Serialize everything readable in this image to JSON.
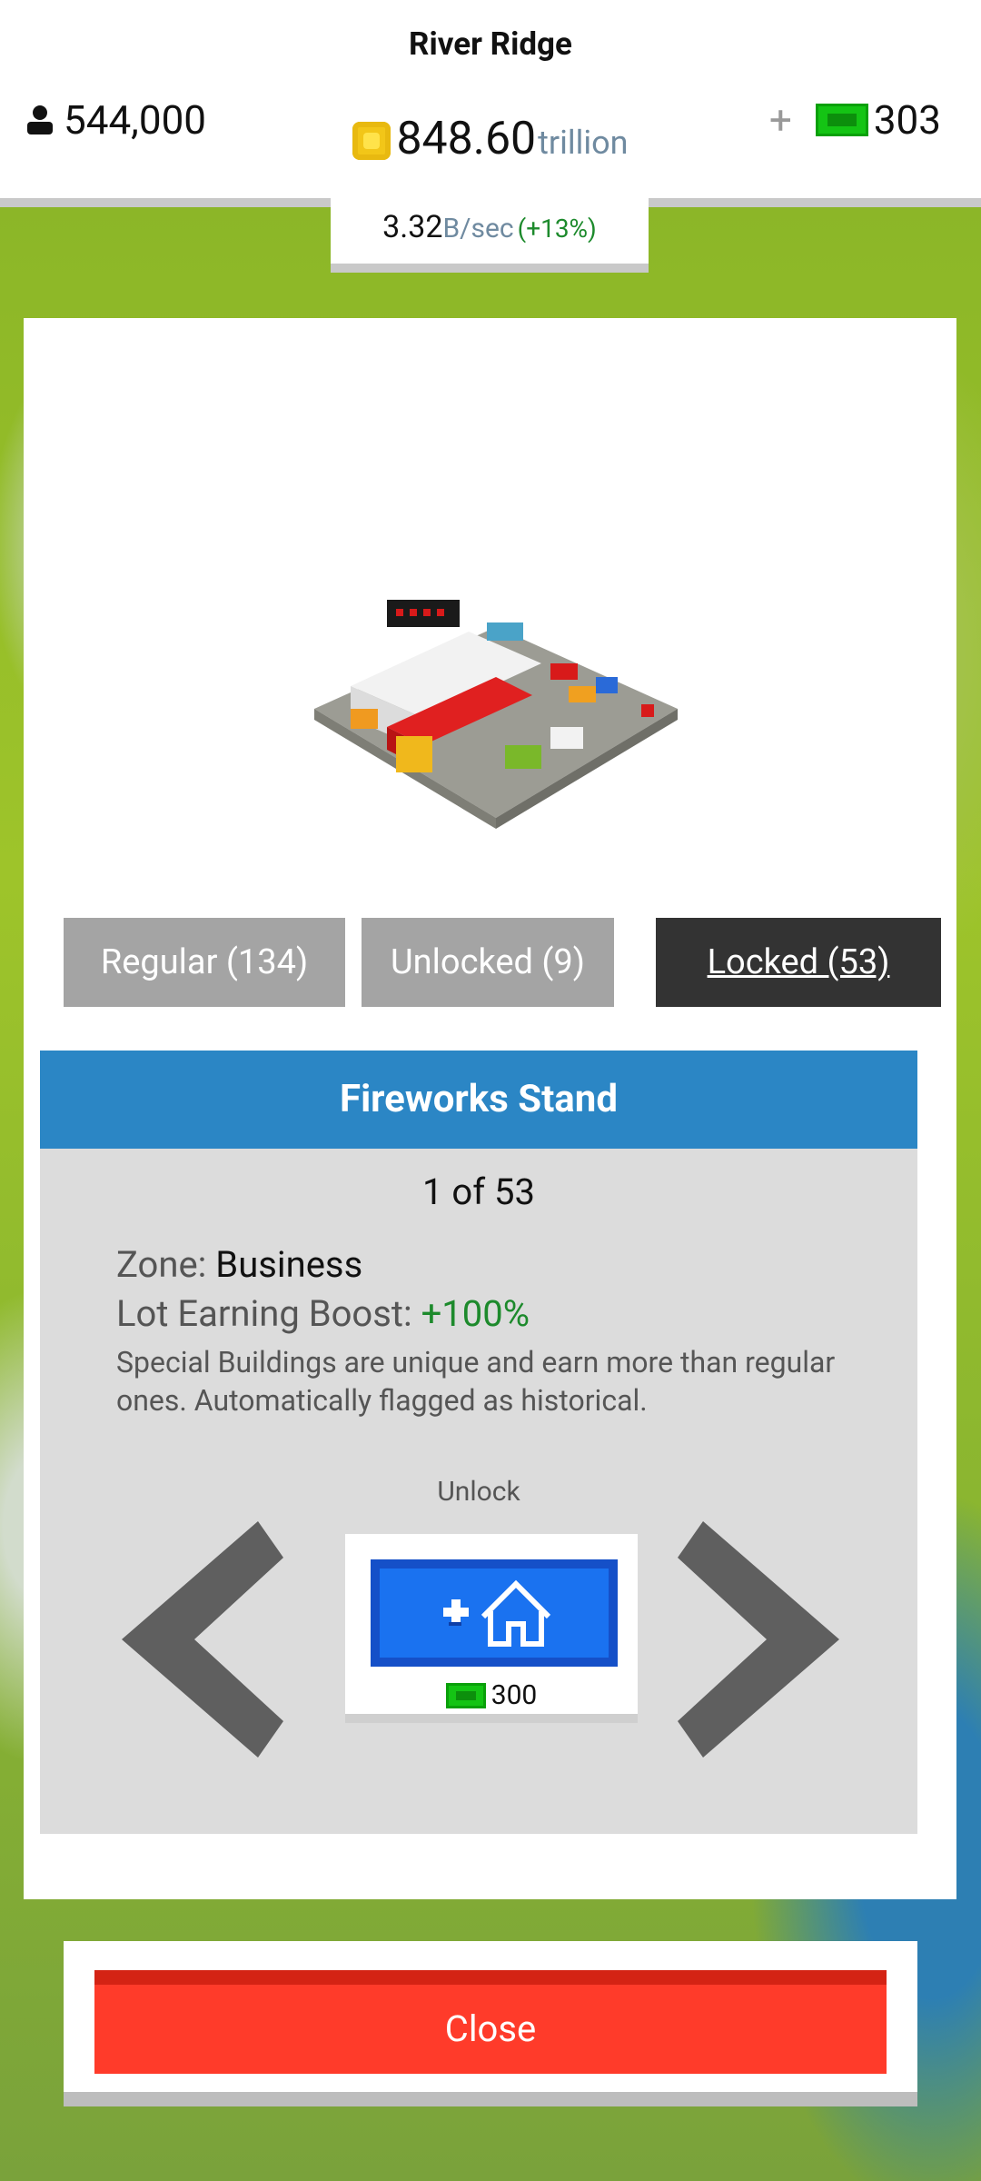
{
  "header": {
    "city_name": "River Ridge",
    "population": "544,000",
    "coins_value": "848.60",
    "coins_unit": "trillion",
    "cash_plus": "+",
    "cash": "303",
    "rate_value": "3.32",
    "rate_unit": "B/sec",
    "rate_boost": "(+13%)"
  },
  "tabs": {
    "regular": "Regular (134)",
    "unlocked": "Unlocked (9)",
    "locked": "Locked (53)",
    "active": "locked"
  },
  "building": {
    "name": "Fireworks Stand",
    "counter": "1 of 53",
    "zone_label": "Zone:",
    "zone_value": "Business",
    "boost_label": "Lot Earning Boost:",
    "boost_value": "+100%",
    "description": "Special Buildings are unique and earn more than regular ones. Automatically flagged as historical."
  },
  "unlock": {
    "label": "Unlock",
    "price": "300",
    "button_icon": "add-house-icon"
  },
  "footer": {
    "close_label": "Close"
  },
  "colors": {
    "title_bar": "#2b86c5",
    "close_button": "#ff3b2a",
    "unlock_button": "#1a72f0",
    "cash_green": "#14c414",
    "boost_green": "#1d8a2c"
  }
}
